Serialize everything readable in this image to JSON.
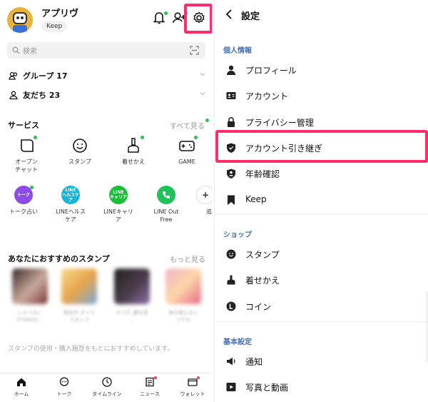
{
  "left": {
    "profile": {
      "name": "アプリヴ",
      "keep_label": "Keep"
    },
    "search": {
      "placeholder": "検索"
    },
    "groups": {
      "label": "グループ 17"
    },
    "friends": {
      "label": "友だち 23"
    },
    "services": {
      "heading": "サービス",
      "see_all": "すべて見る",
      "items": [
        {
          "label": "オープン\nチャット",
          "icon": "open-chat-icon"
        },
        {
          "label": "スタンプ",
          "icon": "sticker-icon"
        },
        {
          "label": "着せかえ",
          "icon": "theme-icon"
        },
        {
          "label": "GAME",
          "icon": "game-icon"
        },
        {
          "label": "トーク占い",
          "icon": "talk-fortune-icon",
          "badge_text": "トーク"
        },
        {
          "label": "LINEヘルス\nケア",
          "icon": "line-healthcare-icon",
          "badge_text": "LINE\nヘルスケア"
        },
        {
          "label": "LINEキャリ\nア",
          "icon": "line-career-icon",
          "badge_text": "LINE\nキャリア"
        },
        {
          "label": "LINE Out\nFree",
          "icon": "line-out-icon"
        },
        {
          "label": "追",
          "icon": "add-service-icon"
        }
      ]
    },
    "recommend": {
      "heading": "あなたにおすすめのスタンプ",
      "more": "もっと見る",
      "note": "スタンプの使用・購入履歴をもとにおすすめしています。",
      "captions": [
        "しゃべる♪\nSTONGS...",
        "無名作 ボイス\nスタンプ",
        "ネコ子_要注意\n...",
        "毎日使えるい\nつでも"
      ]
    },
    "tabs": [
      {
        "label": "ホーム",
        "icon": "home-icon"
      },
      {
        "label": "トーク",
        "icon": "chat-icon"
      },
      {
        "label": "タイムライン",
        "icon": "timeline-icon"
      },
      {
        "label": "ニュース",
        "icon": "news-icon"
      },
      {
        "label": "ウォレット",
        "icon": "wallet-icon"
      }
    ]
  },
  "right": {
    "title": "設定",
    "groups": [
      {
        "heading": "個人情報",
        "items": [
          {
            "label": "プロフィール",
            "icon": "person-icon"
          },
          {
            "label": "アカウント",
            "icon": "id-card-icon"
          },
          {
            "label": "プライバシー管理",
            "icon": "lock-icon"
          },
          {
            "label": "アカウント引き継ぎ",
            "icon": "shield-icon"
          },
          {
            "label": "年齢確認",
            "icon": "age-badge-icon"
          },
          {
            "label": "Keep",
            "icon": "bookmark-icon"
          }
        ]
      },
      {
        "heading": "ショップ",
        "items": [
          {
            "label": "スタンプ",
            "icon": "sticker-icon"
          },
          {
            "label": "着せかえ",
            "icon": "theme-icon"
          },
          {
            "label": "コイン",
            "icon": "coin-icon"
          }
        ]
      },
      {
        "heading": "基本設定",
        "items": [
          {
            "label": "通知",
            "icon": "speaker-icon"
          },
          {
            "label": "写真と動画",
            "icon": "play-icon"
          }
        ]
      }
    ]
  },
  "colors": {
    "accent_highlight": "#ff2d6b",
    "badge_green": "#2bc34a",
    "group_heading": "#4a6fb0"
  }
}
